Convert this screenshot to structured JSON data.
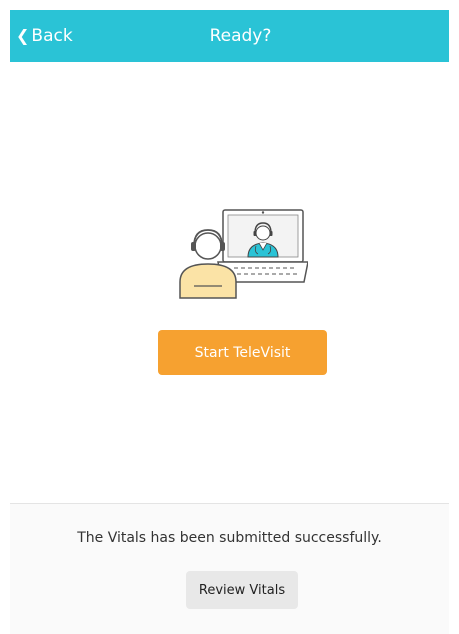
{
  "header": {
    "back_label": "Back",
    "back_icon": "chevron-left-icon",
    "title": "Ready?"
  },
  "illustration": {
    "icon": "televisit-illustration"
  },
  "main": {
    "start_button_label": "Start TeleVisit"
  },
  "footer": {
    "status_message": "The Vitals has been submitted successfully.",
    "review_button_label": "Review Vitals"
  },
  "colors": {
    "header_bg": "#2ac3d6",
    "primary_button": "#f6a130",
    "secondary_button": "#e8e8e8",
    "footer_bg": "#fafafa",
    "illustration_patient": "#fbe3a6",
    "illustration_doctor": "#2ac3d6"
  }
}
